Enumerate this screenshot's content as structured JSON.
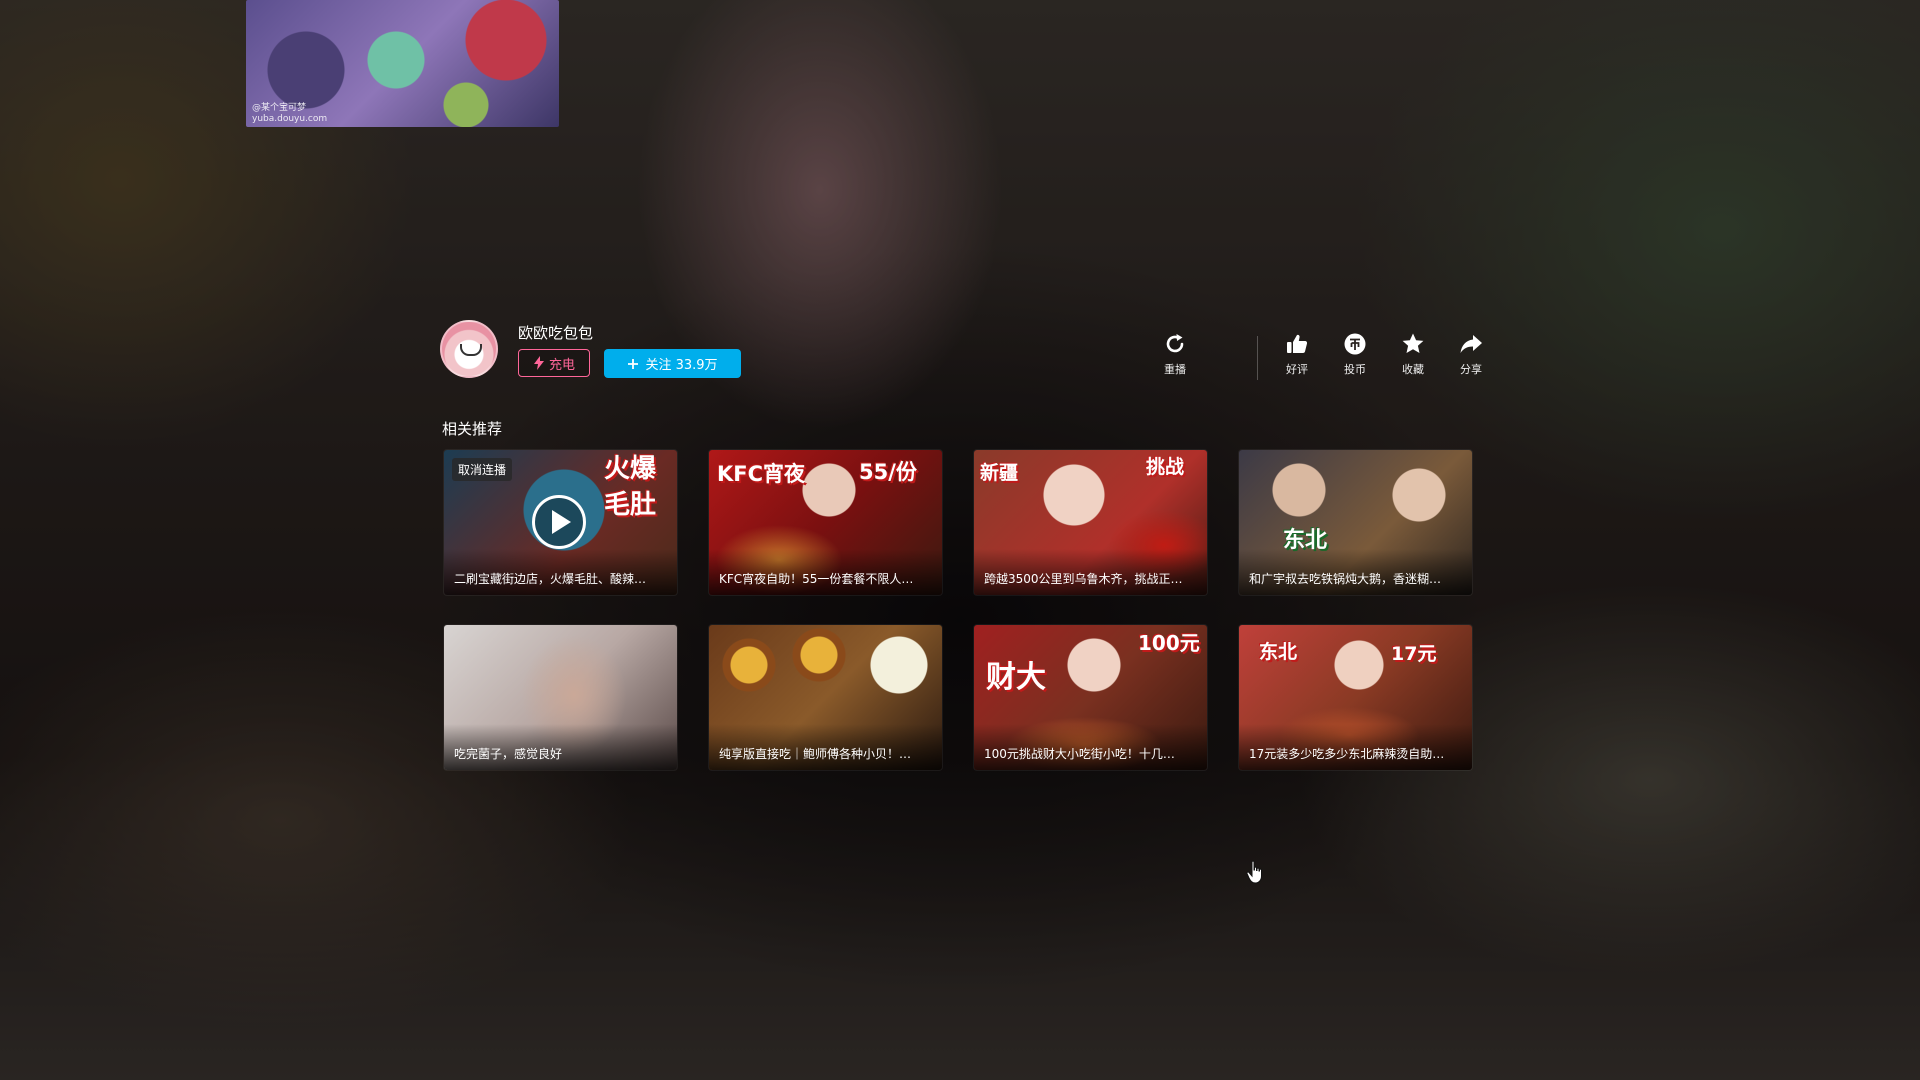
{
  "mini_player": {
    "credit_line1": "@某个宝可梦",
    "credit_line2": "yuba.douyu.com"
  },
  "uploader": {
    "name": "欧欧吃包包",
    "charge_label": "充电",
    "follow_label": "关注 33.9万"
  },
  "actions": [
    {
      "icon": "replay-icon",
      "label": "重播"
    },
    {
      "icon": "thumbs-up-icon",
      "label": "好评"
    },
    {
      "icon": "coin-icon",
      "label": "投币"
    },
    {
      "icon": "star-icon",
      "label": "收藏"
    },
    {
      "icon": "share-icon",
      "label": "分享"
    }
  ],
  "related": {
    "title": "相关推荐",
    "cancel_autoplay_label": "取消连播",
    "videos": [
      {
        "title": "二刷宝藏街边店，火爆毛肚、酸辣…",
        "tag1": "火爆",
        "tag2": "毛肚"
      },
      {
        "title": "KFC宵夜自助！55一份套餐不限人…",
        "tag1": "KFC宵夜",
        "tag2": "55/份"
      },
      {
        "title": "跨越3500公里到乌鲁木齐，挑战正…",
        "tag1": "新疆",
        "tag2": "挑战"
      },
      {
        "title": "和广宇叔去吃铁锅炖大鹅，香迷糊…",
        "tag1": "东北",
        "tag2": ""
      },
      {
        "title": "吃完菌子，感觉良好",
        "tag1": "",
        "tag2": ""
      },
      {
        "title": "纯享版直接吃｜鲍师傅各种小贝！…",
        "tag1": "",
        "tag2": ""
      },
      {
        "title": "100元挑战财大小吃街小吃！十几…",
        "tag1": "100元",
        "tag2": "财大"
      },
      {
        "title": "17元装多少吃多少东北麻辣烫自助…",
        "tag1": "东北",
        "tag2": "17元"
      }
    ]
  },
  "colors": {
    "accent_blue": "#00aeec",
    "charge_pink": "#ff6699"
  }
}
